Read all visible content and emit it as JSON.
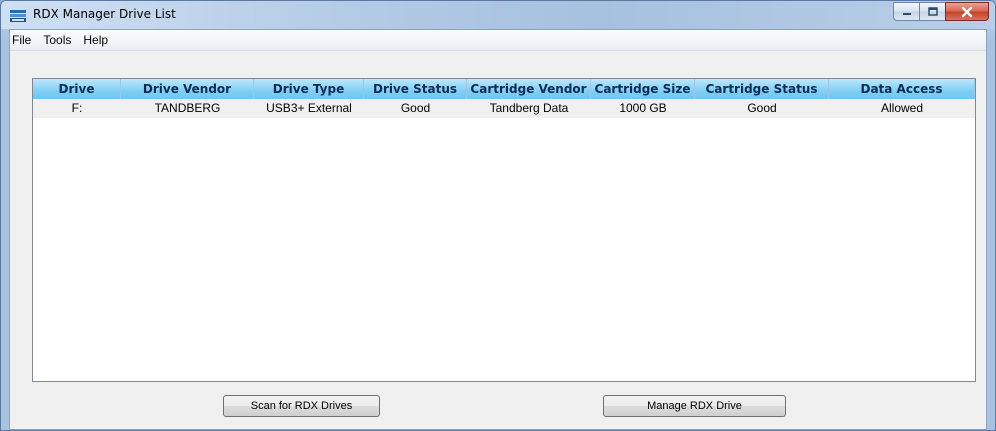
{
  "window": {
    "title": "RDX Manager Drive List"
  },
  "menu": {
    "items": [
      "File",
      "Tools",
      "Help"
    ]
  },
  "table": {
    "columns": [
      "Drive",
      "Drive Vendor",
      "Drive Type",
      "Drive Status",
      "Cartridge Vendor",
      "Cartridge Size",
      "Cartridge Status",
      "Data Access"
    ],
    "rows": [
      [
        "F:",
        "TANDBERG",
        "USB3+ External",
        "Good",
        "Tandberg Data",
        "1000 GB",
        "Good",
        "Allowed"
      ]
    ]
  },
  "buttons": {
    "scan_label": "Scan for RDX Drives",
    "manage_label": "Manage RDX Drive"
  },
  "colors": {
    "header_bg": "#7fcff5",
    "row_bg": "#f0f0f0",
    "close_button": "#c4422a"
  }
}
